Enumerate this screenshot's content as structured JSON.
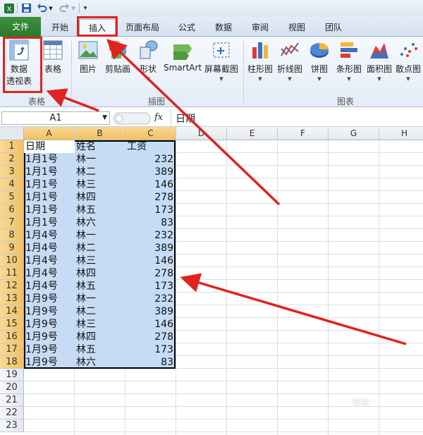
{
  "tabs": [
    "文件",
    "开始",
    "插入",
    "页面布局",
    "公式",
    "数据",
    "审阅",
    "视图",
    "团队"
  ],
  "active_tab": "插入",
  "ribbon": {
    "groups": {
      "tables": "表格",
      "illustrations": "插图",
      "charts": "图表"
    },
    "buttons": {
      "pivot_line1": "数据",
      "pivot_line2": "透视表",
      "table": "表格",
      "picture": "图片",
      "clipart": "剪贴画",
      "shapes": "形状",
      "smartart": "SmartArt",
      "screenshot": "屏幕截图",
      "column": "柱形图",
      "line": "折线图",
      "pie": "饼图",
      "bar": "条形图",
      "area": "面积图",
      "scatter": "散点图"
    }
  },
  "formula_bar": {
    "name_box": "A1",
    "fx": "fx",
    "content": "日期"
  },
  "columns": [
    "A",
    "B",
    "C",
    "D",
    "E",
    "F",
    "G",
    "H"
  ],
  "rows": [
    "1",
    "2",
    "3",
    "4",
    "5",
    "6",
    "7",
    "8",
    "9",
    "10",
    "11",
    "12",
    "13",
    "14",
    "15",
    "16",
    "17",
    "18",
    "19",
    "20",
    "21",
    "22",
    "23"
  ],
  "sheet": {
    "header": [
      "日期",
      "姓名",
      "工资"
    ],
    "data": [
      [
        "1月1号",
        "林一",
        "232"
      ],
      [
        "1月1号",
        "林二",
        "389"
      ],
      [
        "1月1号",
        "林三",
        "146"
      ],
      [
        "1月1号",
        "林四",
        "278"
      ],
      [
        "1月1号",
        "林五",
        "173"
      ],
      [
        "1月1号",
        "林六",
        "83"
      ],
      [
        "1月4号",
        "林一",
        "232"
      ],
      [
        "1月4号",
        "林二",
        "389"
      ],
      [
        "1月4号",
        "林三",
        "146"
      ],
      [
        "1月4号",
        "林四",
        "278"
      ],
      [
        "1月4号",
        "林五",
        "173"
      ],
      [
        "1月9号",
        "林一",
        "232"
      ],
      [
        "1月9号",
        "林二",
        "389"
      ],
      [
        "1月9号",
        "林三",
        "146"
      ],
      [
        "1月9号",
        "林四",
        "278"
      ],
      [
        "1月9号",
        "林五",
        "173"
      ],
      [
        "1月9号",
        "林六",
        "83"
      ]
    ]
  },
  "colors": {
    "annotation": "#e0231f",
    "selection": "#c6dcf5",
    "file_tab": "#2e7d32"
  },
  "watermark": "经验"
}
